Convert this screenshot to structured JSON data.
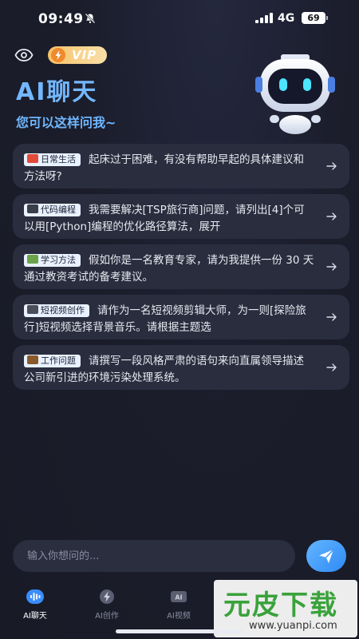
{
  "status_bar": {
    "time": "09:49",
    "network": "4G",
    "battery": "69",
    "icons": [
      "bell-muted-icon",
      "signal-icon",
      "battery-icon"
    ]
  },
  "header": {
    "vip_badge": "VIP",
    "title": "AI聊天",
    "subtitle": "您可以这样问我~",
    "icons": [
      "eye-icon",
      "lightning-icon",
      "robot-avatar"
    ]
  },
  "prompts": [
    {
      "tag": "日常生活",
      "text": "起床过于困难，有没有帮助早起的具体建议和方法呀?",
      "tag_icon": "car-emoji",
      "tag_color": "#e24a3b"
    },
    {
      "tag": "代码编程",
      "text": "我需要解决[TSP旅行商]问题，请列出[4]个可以用[Python]编程的优化路径算法，展开",
      "tag_icon": "laptop-emoji",
      "tag_color": "#3a3f4a"
    },
    {
      "tag": "学习方法",
      "text": "假如你是一名教育专家，请为我提供一份 30 天通过教资考试的备考建议。",
      "tag_icon": "books-emoji",
      "tag_color": "#6aa34a"
    },
    {
      "tag": "短视频创作",
      "text": "请作为一名短视频剪辑大师，为一则[探险旅行]短视频选择背景音乐。请根据主题选",
      "tag_icon": "camera-emoji",
      "tag_color": "#4a4f5a"
    },
    {
      "tag": "工作问题",
      "text": "请撰写一段风格严肃的语句来向直属领导描述公司新引进的环境污染处理系统。",
      "tag_icon": "briefcase-emoji",
      "tag_color": "#8a5a2b"
    }
  ],
  "input": {
    "placeholder": "输入你想问的..."
  },
  "nav": [
    {
      "label": "AI聊天",
      "icon": "sound-wave-icon",
      "active": true
    },
    {
      "label": "AI创作",
      "icon": "lightning-circle-icon",
      "active": false
    },
    {
      "label": "AI视频",
      "icon": "ai-video-icon",
      "active": false
    }
  ],
  "watermark": {
    "logo": "元皮下载",
    "url": "www.yuanpi.com"
  },
  "colors": {
    "accent": "#6fb7ff",
    "card_bg": "#2a2d3e",
    "page_bg": "#1b1d2b",
    "vip_gold": "#f7c36a"
  }
}
